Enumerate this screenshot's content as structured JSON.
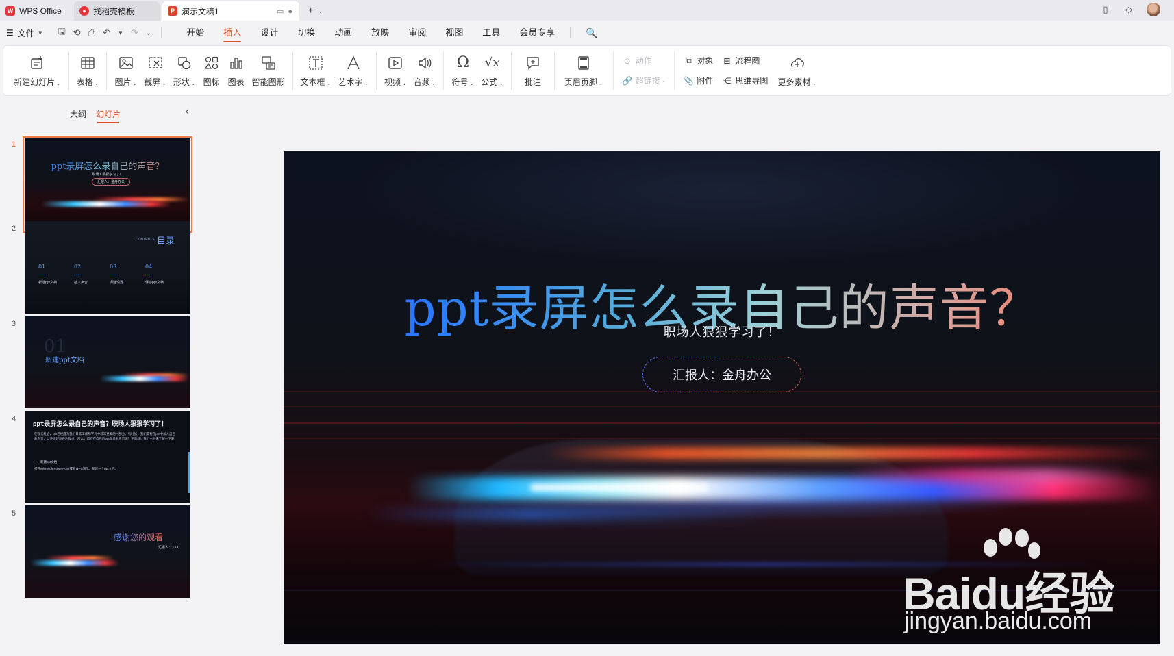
{
  "tabs": [
    {
      "label": "WPS Office"
    },
    {
      "label": "找稻壳模板"
    },
    {
      "label": "演示文稿1"
    }
  ],
  "menubar": {
    "file": "文件",
    "ribbon_tabs": [
      "开始",
      "插入",
      "设计",
      "切换",
      "动画",
      "放映",
      "审阅",
      "视图",
      "工具",
      "会员专享"
    ],
    "active_tab": "插入"
  },
  "ribbon": {
    "new_slide": "新建幻灯片",
    "table": "表格",
    "picture": "图片",
    "screenshot": "截屏",
    "shape": "形状",
    "icon": "图标",
    "chart": "图表",
    "smartart": "智能图形",
    "textbox": "文本框",
    "wordart": "艺术字",
    "video": "视频",
    "audio": "音频",
    "symbol": "符号",
    "formula": "公式",
    "comment": "批注",
    "header_footer": "页眉页脚",
    "action": "动作",
    "hyperlink": "超链接",
    "object": "对象",
    "attachment": "附件",
    "flowchart": "流程图",
    "mindmap": "思维导图",
    "more_material": "更多素材"
  },
  "panel": {
    "outline_tab": "大纲",
    "slides_tab": "幻灯片"
  },
  "thumbnails": {
    "nums": [
      "1",
      "2",
      "3",
      "4",
      "5"
    ],
    "t1": {
      "title": "ppt录屏怎么录自己的声音？",
      "sub": "职场人狠狠学习了！",
      "pill": "汇报人：金舟办公"
    },
    "t2": {
      "contents": "CONTENTS",
      "title": "目录",
      "items": [
        {
          "num": "01",
          "label": "新建ppt文档"
        },
        {
          "num": "02",
          "label": "插入声音"
        },
        {
          "num": "03",
          "label": "调整设置"
        },
        {
          "num": "04",
          "label": "保存ppt文档"
        }
      ]
    },
    "t3": {
      "num": "01",
      "title": "新建ppt文档"
    },
    "t4": {
      "title": "ppt录屏怎么录自己的声音？职场人狠狠学习了！",
      "body1": "在现代社会，ppt已经成为我们日常工作和学习中非常重要的一部分。有时候，我们需要在ppt中加入自己的声音，以便更好地表达观点。那么，如何在自己的ppt里录制声音呢？下面就让我们一起来了解一下吧。",
      "bullet1": "一、新建ppt文档",
      "bullet2": "打开Microsoft PowerPoint或者WPS演示，新建一个ppt文档。"
    },
    "t5": {
      "title": "感谢您的观看",
      "sub": "汇报人：XXX"
    }
  },
  "slide": {
    "title": "ppt录屏怎么录自己的声音？",
    "subtitle": "职场人狠狠学习了！",
    "reporter": "汇报人：金舟办公"
  },
  "watermark": {
    "brand": "Baidu经验",
    "url": "jingyan.baidu.com"
  },
  "colors": {
    "accent": "#d9532b",
    "slide_bg": "#0c1019",
    "title_start": "#1d55ff",
    "title_end": "#ff5a3a"
  }
}
